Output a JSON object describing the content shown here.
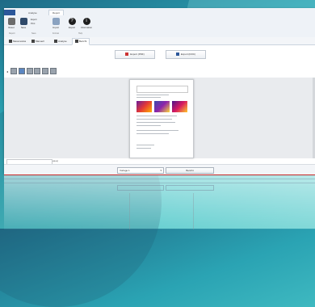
{
  "ribbon": {
    "file_tab": "",
    "tabs": [
      "Analyse",
      "Report"
    ],
    "buttons": [
      {
        "label": "Reset",
        "icon": "reset-icon"
      },
      {
        "label": "Save",
        "icon": "floppy-icon"
      },
      {
        "label": "Import",
        "icon": "import-icon"
      },
      {
        "label": "Export",
        "icon": "export-icon"
      },
      {
        "label": "Information",
        "icon": "info-icon"
      }
    ],
    "small_items": [
      "Export",
      "Print"
    ],
    "groups": [
      "Report",
      "Save",
      "Format",
      "Help"
    ]
  },
  "doc_tabs": [
    "Messmodus",
    "Manuell",
    "Analyse",
    "Bericht"
  ],
  "export_buttons": [
    "Export (PDF)",
    "Export (DOC)"
  ],
  "footer": {
    "select_value": "Vorlage 1",
    "action_button": "Bericht"
  },
  "colors": {
    "accent": "#2b579a",
    "bg_teal": "#2aa3b3",
    "red_line": "#c62828"
  }
}
